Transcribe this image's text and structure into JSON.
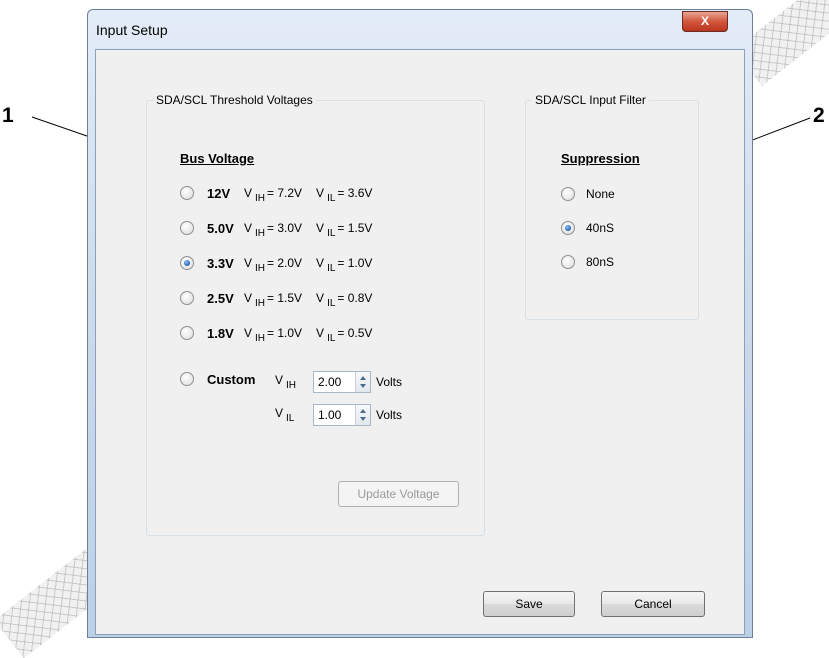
{
  "callouts": {
    "c1": "1",
    "c2": "2"
  },
  "window": {
    "title": "Input Setup",
    "close_glyph": "X"
  },
  "threshold": {
    "group_title": "SDA/SCL Threshold Voltages",
    "heading": "Bus Voltage",
    "v": "V",
    "ih": "IH",
    "il": "IL",
    "options": [
      {
        "label": "12V",
        "vih": "= 7.2V",
        "vil": "= 3.6V",
        "checked": false
      },
      {
        "label": "5.0V",
        "vih": "= 3.0V",
        "vil": "= 1.5V",
        "checked": false
      },
      {
        "label": "3.3V",
        "vih": "= 2.0V",
        "vil": "= 1.0V",
        "checked": true
      },
      {
        "label": "2.5V",
        "vih": "= 1.5V",
        "vil": "= 0.8V",
        "checked": false
      },
      {
        "label": "1.8V",
        "vih": "= 1.0V",
        "vil": "= 0.5V",
        "checked": false
      }
    ],
    "custom": {
      "label": "Custom",
      "vih_value": "2.00",
      "vil_value": "1.00",
      "unit": "Volts",
      "checked": false
    },
    "update_button": "Update Voltage"
  },
  "filter": {
    "group_title": "SDA/SCL Input Filter",
    "heading": "Suppression",
    "options": [
      {
        "label": "None",
        "checked": false
      },
      {
        "label": "40nS",
        "checked": true
      },
      {
        "label": "80nS",
        "checked": false
      }
    ]
  },
  "buttons": {
    "save": "Save",
    "cancel": "Cancel"
  }
}
